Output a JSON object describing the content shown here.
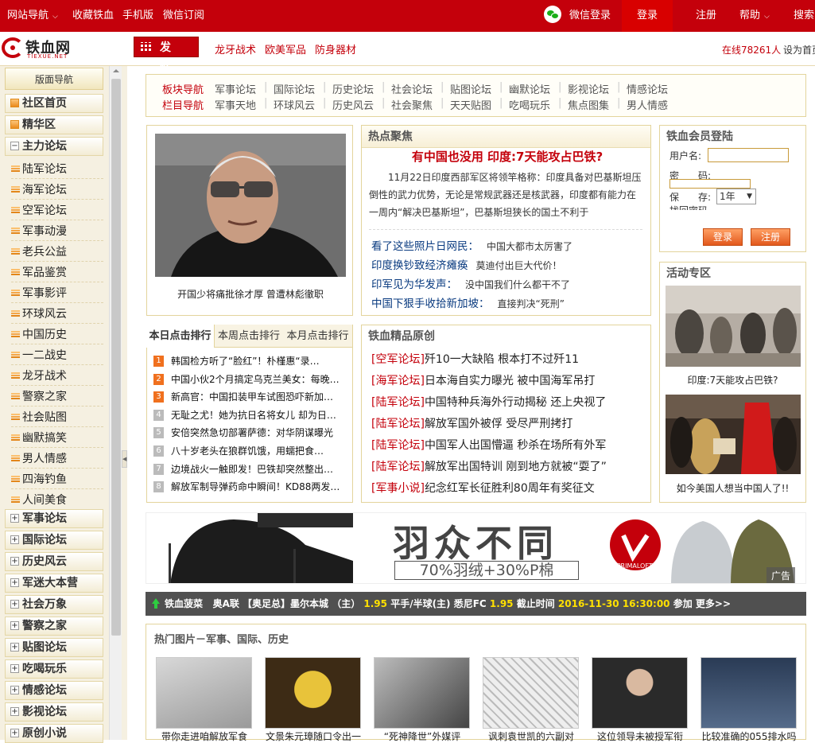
{
  "topbar": {
    "site_nav": "网站导航",
    "bookmark": "收藏铁血",
    "mobile": "手机版",
    "wechat_sub": "微信订阅",
    "wechat_login": "微信登录",
    "login": "登录",
    "register": "注册",
    "help": "帮助",
    "search": "搜索"
  },
  "logo": {
    "name": "铁血网",
    "sub": "TIEXUE.NET"
  },
  "post_button": "发帖",
  "sub_links": [
    "龙牙战术",
    "欧美军品",
    "防身器材"
  ],
  "online": "在线78261人",
  "set_home": "设为首页",
  "sidebar": {
    "title": "版面导航",
    "top_items": [
      "社区首页",
      "精华区",
      "主力论坛"
    ],
    "sub_items": [
      "陆军论坛",
      "海军论坛",
      "空军论坛",
      "军事动漫",
      "老兵公益",
      "军品鉴赏",
      "军事影评",
      "环球风云",
      "中国历史",
      "一二战史",
      "龙牙战术",
      "警察之家",
      "社会贴图",
      "幽默搞笑",
      "男人情感",
      "四海钓鱼",
      "人间美食"
    ],
    "bottom_items": [
      "军事论坛",
      "国际论坛",
      "历史风云",
      "军迷大本营",
      "社会万象",
      "警察之家",
      "贴图论坛",
      "吃喝玩乐",
      "情感论坛",
      "影视论坛",
      "原创小说"
    ]
  },
  "nav": {
    "row1_label": "板块导航",
    "row1": [
      "军事论坛",
      "国际论坛",
      "历史论坛",
      "社会论坛",
      "贴图论坛",
      "幽默论坛",
      "影视论坛",
      "情感论坛"
    ],
    "row2_label": "栏目导航",
    "row2": [
      "军事天地",
      "环球风云",
      "历史风云",
      "社会聚焦",
      "天天贴图",
      "吃喝玩乐",
      "焦点图集",
      "男人情感"
    ]
  },
  "feature_photo": {
    "caption": "开国少将痛批徐才厚 曾遭林彪徹职"
  },
  "hot": {
    "header": "热点聚焦",
    "title": "有中国也没用 印度:7天能攻占巴铁?",
    "para": "11月22日印度西部军区将领竿格称：印度具备对巴基斯坦压倒性的武力优势，无论是常规武器还是核武器，印度都有能力在一周内“解决巴基斯坦”，巴基斯坦狭长的国土不利于",
    "links": [
      {
        "a": "看了这些照片日网民：",
        "b": "中国大都市太厉害了"
      },
      {
        "a": "印度换钞致经济瘫痪",
        "b": "莫迪付出巨大代价！"
      },
      {
        "a": "印军见为华发声：",
        "b": "没中国我们什么都干不了"
      },
      {
        "a": "中国下狠手收拾新加坡：",
        "b": "直接判决“死刑”"
      }
    ]
  },
  "member": {
    "header": "铁血会员登陆",
    "username": "用户名:",
    "password": "密　　码:",
    "save": "保　　存:",
    "save_value": "1年",
    "forgot": "找回密码",
    "login_btn": "登录",
    "register_btn": "注册"
  },
  "activity": {
    "header": "活动专区",
    "cap1": "印度:7天能攻占巴铁?",
    "cap2": "如今美国人想当中国人了!!"
  },
  "ranking": {
    "tabs": [
      "本日点击排行",
      "本周点击排行",
      "本月点击排行"
    ],
    "items": [
      "韩国检方听了“脸红”！朴槿惠“录…",
      "中国小伙2个月搞定乌克兰美女：每晚…",
      "新高官：中国扣装甲车试图恐吓新加…",
      "无耻之尤！她为抗日名将女儿 却为日…",
      "安倍突然急切部署萨德：对华阴谋曝光",
      "八十岁老头在狼群饥饿，用蠕把食…",
      "边境战火一触即发！巴铁却突然整出…",
      "解放军制导弹药命中瞬间！KD88两发…"
    ]
  },
  "originals": {
    "header": "铁血精品原创",
    "items": [
      {
        "tag": "[空军论坛]",
        "t": "歼10一大缺陷 根本打不过歼11"
      },
      {
        "tag": "[海军论坛]",
        "t": "日本海自实力曝光 被中国海军吊打"
      },
      {
        "tag": "[陆军论坛]",
        "t": "中国特种兵海外行动揭秘 还上央视了"
      },
      {
        "tag": "[陆军论坛]",
        "t": "解放军国外被俘 受尽严刑拷打"
      },
      {
        "tag": "[陆军论坛]",
        "t": "中国军人出国懵逼 秒杀在场所有外军"
      },
      {
        "tag": "[陆军论坛]",
        "t": "解放军出国特训 刚到地方就被“耍了”"
      },
      {
        "tag": "[军事小说]",
        "t": "纪念红军长征胜利80周年有奖征文"
      }
    ]
  },
  "ad": {
    "slogan": "羽众不同",
    "sub": "70%羽绒+30%P棉",
    "brand": "PRIMALOFT.",
    "tag": "广告"
  },
  "ticker": {
    "prefix": "铁血菠菜",
    "match": "奥A联 【奥足总】墨尔本城 （主） ",
    "o1": "1.95",
    "mid": " 平手/半球(主) 悉尼FC ",
    "o2": "1.95",
    "deadline_label": " 截止时间 ",
    "deadline": "2016-11-30 16:30:00",
    "join": " 参加 ",
    "more": "更多>>"
  },
  "pics": {
    "header": "热门图片－军事、国际、历史",
    "caps": [
      "带你走进咱解放军食",
      "文景朱元璋随口令出一",
      "“死神降世”外媒评",
      "讽刺袁世凯的六副对",
      "这位领导未被授军衔",
      "比较准确的055排水吗"
    ]
  },
  "colors": {
    "brand_red": "#c4000b",
    "link_blue": "#0a3b80",
    "box_border": "#e3d49c"
  }
}
